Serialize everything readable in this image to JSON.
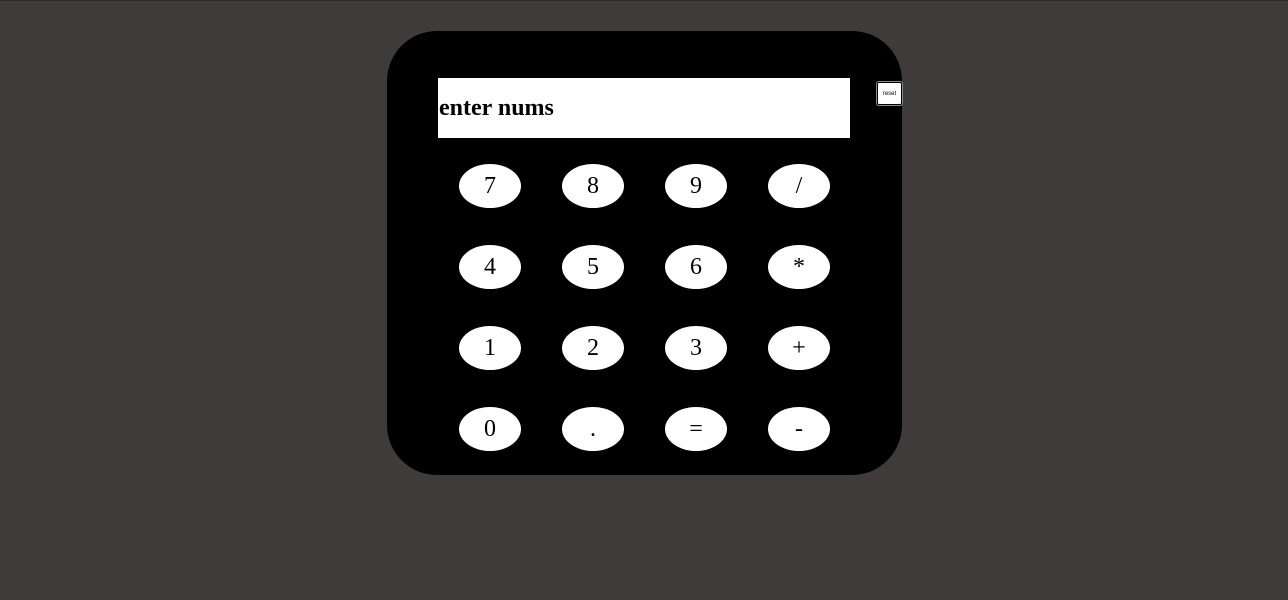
{
  "display": {
    "placeholder": "enter nums"
  },
  "keypad": {
    "rows": [
      [
        "7",
        "8",
        "9",
        "/"
      ],
      [
        "4",
        "5",
        "6",
        "*"
      ],
      [
        "1",
        "2",
        "3",
        "+"
      ],
      [
        "0",
        ".",
        "=",
        "-"
      ]
    ]
  },
  "reset": {
    "label": "reset"
  },
  "colors": {
    "background": "#3f3b3b",
    "calculator_body": "#000000",
    "keys": "#ffffff"
  }
}
